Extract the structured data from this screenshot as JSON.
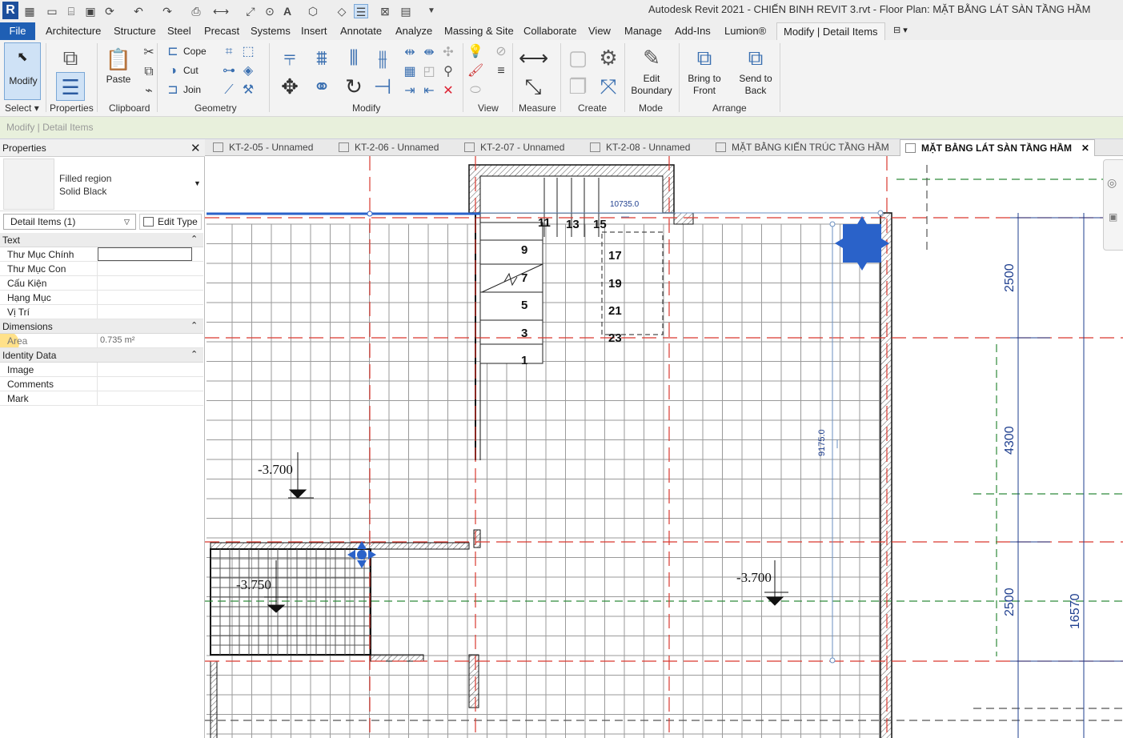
{
  "window": {
    "title": "Autodesk Revit 2021 - CHIẾN BINH REVIT 3.rvt - Floor Plan: MẶT BẰNG LÁT SÀN TẦNG HẦM",
    "logo": "R"
  },
  "menubar": {
    "items": [
      "File",
      "Architecture",
      "Structure",
      "Steel",
      "Precast",
      "Systems",
      "Insert",
      "Annotate",
      "Analyze",
      "Massing & Site",
      "Collaborate",
      "View",
      "Manage",
      "Add-Ins",
      "Lumion®",
      "Modify | Detail Items"
    ]
  },
  "ribbon": {
    "modify_label": "Modify",
    "properties_label": "Properties",
    "paste_label": "Paste",
    "cope_label": "Cope",
    "cut_label": "Cut",
    "join_label": "Join",
    "edit_boundary_label": "Edit\nBoundary",
    "bring_front_label": "Bring to\nFront",
    "send_back_label": "Send to\nBack",
    "panels": {
      "select": "Select",
      "properties": "Properties",
      "clipboard": "Clipboard",
      "geometry": "Geometry",
      "modify": "Modify",
      "view": "View",
      "measure": "Measure",
      "create": "Create",
      "mode": "Mode",
      "arrange": "Arrange"
    }
  },
  "options_bar": {
    "context": "Modify | Detail Items"
  },
  "properties": {
    "title": "Properties",
    "type_name": "Filled region",
    "type_sub": "Solid Black",
    "instance_selector": "Detail Items (1)",
    "edit_type_label": "Edit Type",
    "groups": {
      "text": "Text",
      "dimensions": "Dimensions",
      "identity": "Identity Data"
    },
    "text_rows": [
      "Thư Mục Chính",
      "Thư Mục Con",
      "Cấu Kiện",
      "Hạng Mục",
      "Vị Trí"
    ],
    "area_label": "Area",
    "area_value": "0.735 m²",
    "identity_rows": [
      "Image",
      "Comments",
      "Mark"
    ]
  },
  "view_tabs": [
    {
      "label": "KT-2-05 - Unnamed"
    },
    {
      "label": "KT-2-06 - Unnamed"
    },
    {
      "label": "KT-2-07 - Unnamed"
    },
    {
      "label": "KT-2-08 - Unnamed"
    },
    {
      "label": "MẶT BẰNG KIẾN TRÚC TẦNG HẦM"
    },
    {
      "label": "MẶT BẰNG LÁT SÀN TẦNG HẦM",
      "active": true
    }
  ],
  "drawing": {
    "stair_numbers_left": [
      "11",
      "9",
      "7",
      "5",
      "3",
      "1"
    ],
    "stair_numbers_right": [
      "13",
      "15",
      "17",
      "19",
      "21",
      "23"
    ],
    "dim_top": "10735.0",
    "dim_vertical": "9175.0",
    "level_left": "-3.700",
    "level_pit": "-3.750",
    "level_right": "-3.700",
    "dim_right_1": "2500",
    "dim_right_2": "4300",
    "dim_right_3": "2500",
    "dim_right_total": "16570"
  },
  "colors": {
    "accent": "#1f5fb4",
    "selection": "#2a62c9",
    "grid_red": "#d9382f",
    "grid_green": "#2f8a3a",
    "dim_blue": "#1f3f8f"
  }
}
